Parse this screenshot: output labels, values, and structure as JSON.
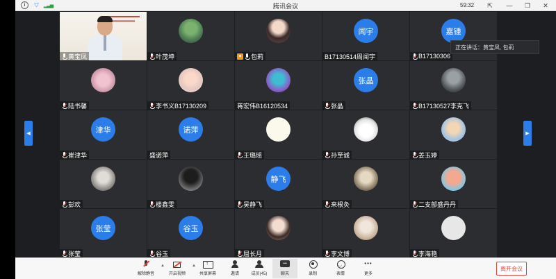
{
  "titlebar": {
    "title": "腾讯会议",
    "time": "59:32",
    "icons": [
      "info-icon",
      "shield-icon",
      "signal-icon"
    ],
    "buttons": [
      "pin-icon",
      "minimize-icon",
      "maximize-icon",
      "close-icon"
    ]
  },
  "participants": [
    {
      "name": "黄宝凤",
      "kind": "video",
      "mic": "on"
    },
    {
      "name": "叶茂坤",
      "kind": "image",
      "style": "img1",
      "mic": "muted"
    },
    {
      "name": "包莉",
      "kind": "image",
      "style": "img2",
      "mic": "on",
      "host": true
    },
    {
      "name": "B17130514周闻宇",
      "kind": "text",
      "initials": "闻宇",
      "mic": "none"
    },
    {
      "name": "B17130306",
      "kind": "text",
      "initials": "嘉锺",
      "mic": "muted"
    },
    {
      "name": "陆书馨",
      "kind": "image",
      "style": "img3",
      "mic": "muted"
    },
    {
      "name": "李书义B17130209",
      "kind": "image",
      "style": "img4",
      "mic": "muted"
    },
    {
      "name": "蒋宏伟B16120534",
      "kind": "image",
      "style": "img5",
      "mic": "none"
    },
    {
      "name": "张晶",
      "kind": "text",
      "initials": "张晶",
      "mic": "muted"
    },
    {
      "name": "B17130527李克飞",
      "kind": "image",
      "style": "img6",
      "mic": "muted"
    },
    {
      "name": "崔津华",
      "kind": "text",
      "initials": "津华",
      "mic": "muted"
    },
    {
      "name": "盛诺萍",
      "kind": "text",
      "initials": "诺萍",
      "mic": "none"
    },
    {
      "name": "王璐瑶",
      "kind": "image",
      "style": "white",
      "mic": "muted"
    },
    {
      "name": "孙至诚",
      "kind": "image",
      "style": "img7",
      "mic": "muted"
    },
    {
      "name": "姜玉婷",
      "kind": "image",
      "style": "img8",
      "mic": "muted"
    },
    {
      "name": "彭欢",
      "kind": "image",
      "style": "img9",
      "mic": "muted"
    },
    {
      "name": "楼鑫雯",
      "kind": "image",
      "style": "img10",
      "mic": "muted"
    },
    {
      "name": "吴静飞",
      "kind": "text",
      "initials": "静飞",
      "mic": "muted"
    },
    {
      "name": "来根灸",
      "kind": "image",
      "style": "img11",
      "mic": "muted"
    },
    {
      "name": "二支部盛丹丹",
      "kind": "image",
      "style": "img12",
      "mic": "muted"
    },
    {
      "name": "张莹",
      "kind": "text",
      "initials": "张莹",
      "mic": "muted"
    },
    {
      "name": "谷玉",
      "kind": "text",
      "initials": "谷玉",
      "mic": "muted"
    },
    {
      "name": "屈长月",
      "kind": "image",
      "style": "img13",
      "mic": "muted"
    },
    {
      "name": "李文博",
      "kind": "image",
      "style": "img14",
      "mic": "muted"
    },
    {
      "name": "李海艳",
      "kind": "image",
      "style": "blank",
      "mic": "muted"
    }
  ],
  "speaking": {
    "text": "正在讲话：黄宝凤, 包莉"
  },
  "toolbar": {
    "mute_label": "解除静音",
    "video_label": "开启视频",
    "share_label": "共享屏幕",
    "invite_label": "邀请",
    "members_label": "成员(45)",
    "chat_label": "聊天",
    "record_label": "录制",
    "reactions_label": "表情",
    "more_label": "更多",
    "leave_label": "离开会议"
  },
  "colors": {
    "accent": "#2b7de9",
    "danger": "#e5453a",
    "tile": "#2c2d31",
    "background": "#1d1e22"
  }
}
